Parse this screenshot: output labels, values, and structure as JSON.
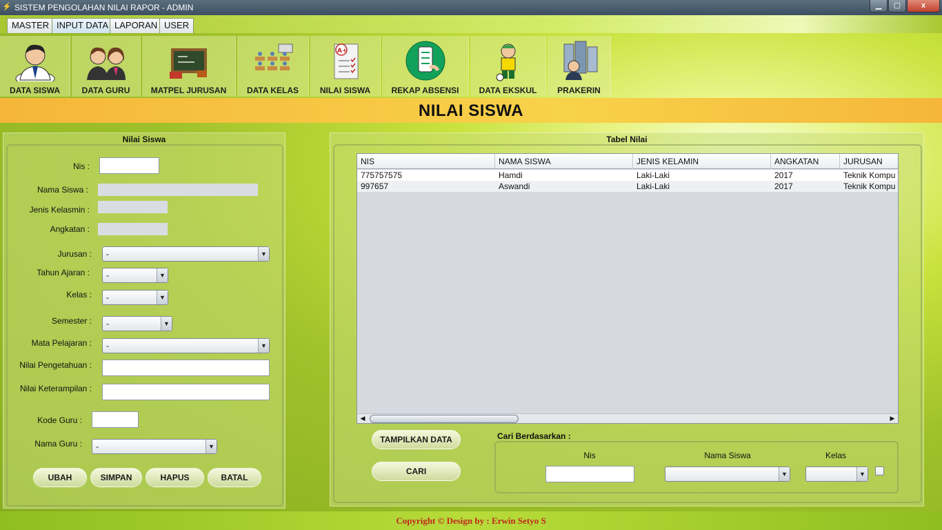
{
  "window": {
    "title": "SISTEM PENGOLAHAN NILAI RAPOR - ADMIN",
    "minimize_icon": "minimize-icon",
    "maximize_icon": "maximize-icon",
    "close_label": "x"
  },
  "menu": {
    "items": [
      {
        "label": "MASTER"
      },
      {
        "label": "INPUT DATA"
      },
      {
        "label": "LAPORAN"
      },
      {
        "label": "USER"
      }
    ],
    "active": "INPUT DATA"
  },
  "toolbar": {
    "items": [
      {
        "label": "DATA SISWA",
        "icon": "student-icon"
      },
      {
        "label": "DATA GURU",
        "icon": "teachers-icon"
      },
      {
        "label": "MATPEL JURUSAN",
        "icon": "blackboard-icon"
      },
      {
        "label": "DATA KELAS",
        "icon": "classroom-icon"
      },
      {
        "label": "NILAI SISWA",
        "icon": "grade-sheet-icon"
      },
      {
        "label": "REKAP ABSENSI",
        "icon": "attendance-icon"
      },
      {
        "label": "DATA EKSKUL",
        "icon": "extracurricular-icon"
      },
      {
        "label": "PRAKERIN",
        "icon": "internship-icon"
      }
    ]
  },
  "page": {
    "title": "NILAI SISWA"
  },
  "form": {
    "title": "Nilai Siswa",
    "labels": {
      "nis": "Nis :",
      "nama_siswa": "Nama Siswa :",
      "jenis_kelamin": "Jenis Kelasmin :",
      "angkatan": "Angkatan :",
      "jurusan": "Jurusan :",
      "tahun_ajaran": "Tahun Ajaran :",
      "kelas": "Kelas :",
      "semester": "Semester :",
      "mata_pelajaran": "Mata Pelajaran :",
      "nilai_pengetahuan": "Nilai Pengetahuan :",
      "nilai_keterampilan": "Nilai Keterampilan :",
      "kode_guru": "Kode Guru :",
      "nama_guru": "Nama Guru :"
    },
    "values": {
      "nis": "",
      "nama_siswa": "",
      "jenis_kelamin": "",
      "angkatan": "",
      "jurusan": "-",
      "tahun_ajaran": "-",
      "kelas": "-",
      "semester": "-",
      "mata_pelajaran": "-",
      "nilai_pengetahuan": "",
      "nilai_keterampilan": "",
      "kode_guru": "",
      "nama_guru": "-"
    },
    "buttons": {
      "ubah": "UBAH",
      "simpan": "SIMPAN",
      "hapus": "HAPUS",
      "batal": "BATAL"
    }
  },
  "table": {
    "title": "Tabel Nilai",
    "columns": [
      "NIS",
      "NAMA SISWA",
      "JENIS KELAMIN",
      "ANGKATAN",
      "JURUSAN"
    ],
    "rows": [
      [
        "775757575",
        "Hamdi",
        "Laki-Laki",
        "2017",
        "Teknik Kompu"
      ],
      [
        "997657",
        "Aswandi",
        "Laki-Laki",
        "2017",
        "Teknik Kompu"
      ]
    ],
    "buttons": {
      "tampilkan": "TAMPILKAN DATA",
      "cari": "CARI"
    }
  },
  "search": {
    "title": "Cari Berdasarkan :",
    "labels": {
      "nis": "Nis",
      "nama_siswa": "Nama Siswa",
      "kelas": "Kelas"
    },
    "values": {
      "nis": "",
      "nama_siswa": "",
      "kelas": ""
    }
  },
  "footer": {
    "copyright": "Copyright © Design by : Erwin Setyo S"
  },
  "colors": {
    "header_band": "#f7c645",
    "copyright_text": "#c0281e",
    "background": "#b9d930"
  }
}
